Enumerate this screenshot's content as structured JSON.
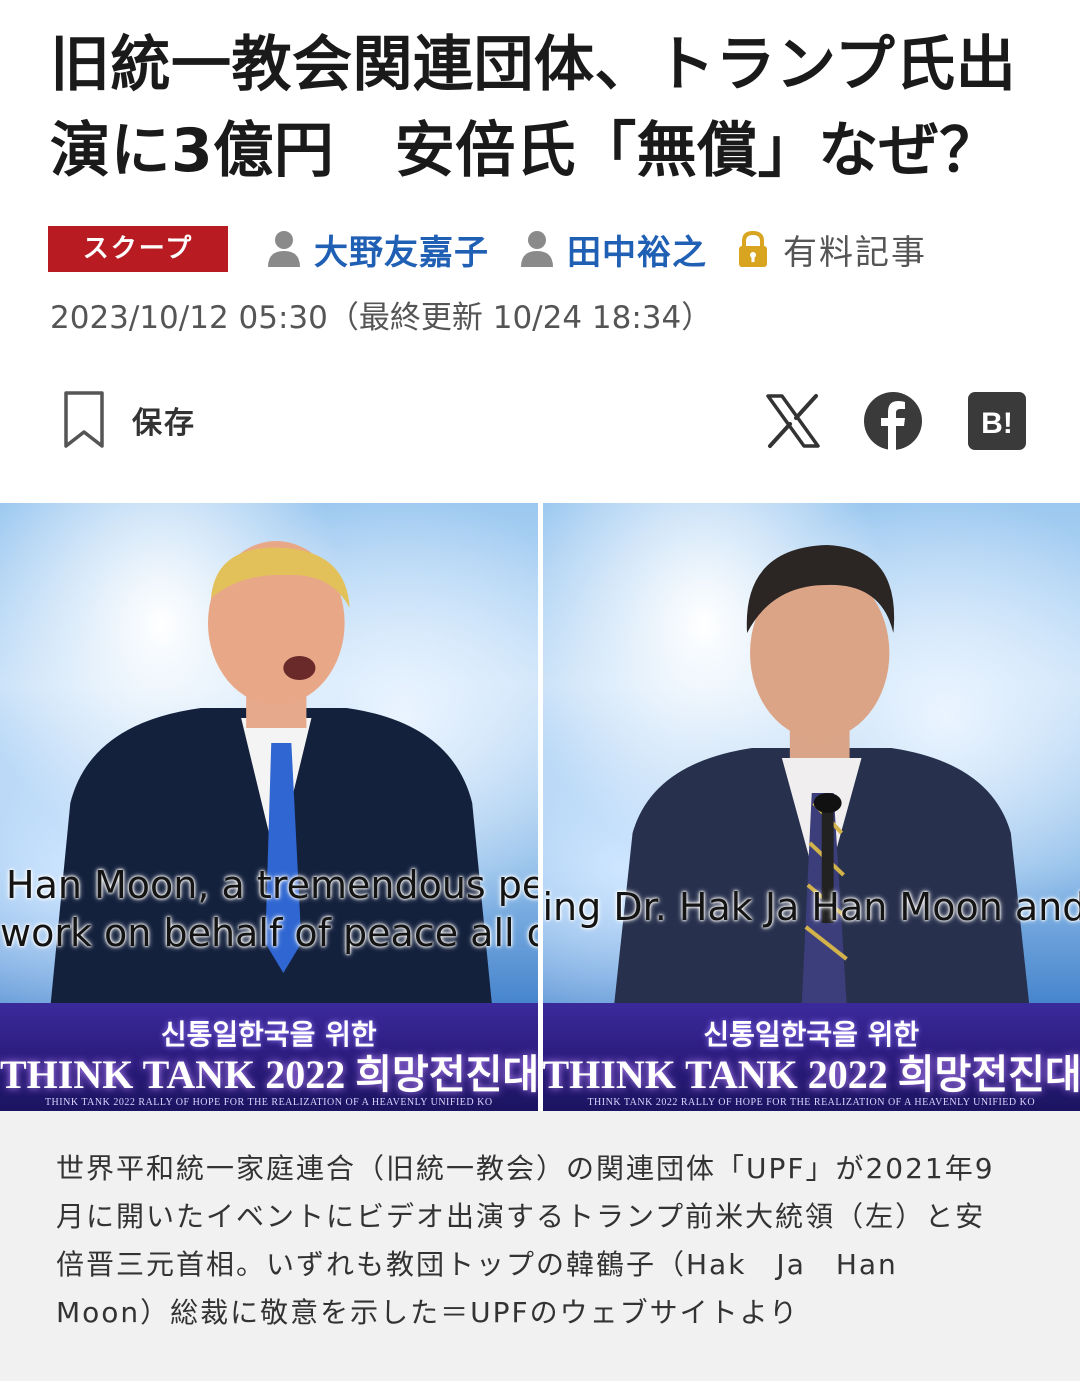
{
  "headline": {
    "line1": "旧統一教会関連団体、トランプ氏出",
    "line2": "演に3億円　安倍氏「無償」なぜ？"
  },
  "badge": "スクープ",
  "authors": [
    "大野友嘉子",
    "田中裕之"
  ],
  "paid_label": "有料記事",
  "date": "2023/10/12 05:30（最終更新 10/24 18:34）",
  "save_label": "保存",
  "share": {
    "hatena_label": "B!"
  },
  "photo": {
    "left": {
      "subtitle_line1": "Han Moon, a tremendous pe",
      "subtitle_line2": "work on behalf of peace all ov",
      "banner_korean": "신통일한국을 위한",
      "banner_main": "THINK TANK 2022 희망전진대",
      "banner_small": "THINK TANK 2022 RALLY OF HOPE FOR THE REALIZATION OF A HEAVENLY UNIFIED KO"
    },
    "right": {
      "subtitle_line1": "ing Dr. Hak Ja Han Moon and",
      "banner_korean": "신통일한국을 위한",
      "banner_main": "THINK TANK 2022 희망전진대",
      "banner_small": "THINK TANK 2022 RALLY OF HOPE FOR THE REALIZATION OF A HEAVENLY UNIFIED KO"
    }
  },
  "caption": {
    "line1": "世界平和統一家庭連合（旧統一教会）の関連団体「UPF」が2021年9",
    "line2": "月に開いたイベントにビデオ出演するトランプ前米大統領（左）と安",
    "line3": "倍晋三元首相。いずれも教団トップの韓鶴子（Hak　Ja　Han",
    "line4": "Moon）総裁に敬意を示した＝UPFのウェブサイトより"
  },
  "colors": {
    "badge": "#b81c22",
    "author_link": "#1f5fb4",
    "lock": "#d9a520",
    "caption_bg": "#f1f1f1"
  }
}
